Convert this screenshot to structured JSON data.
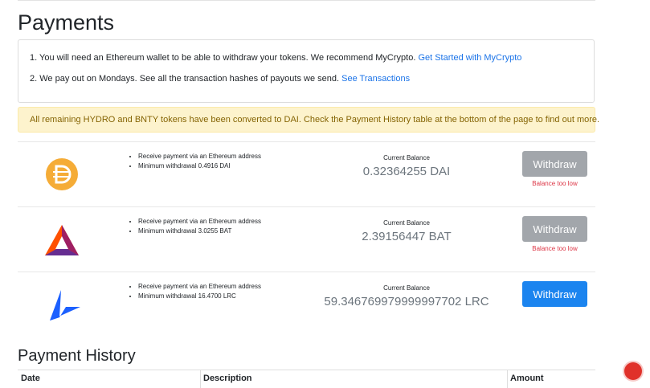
{
  "page": {
    "title": "Payments"
  },
  "info": {
    "line1_text": "1. You will need an Ethereum wallet to be able to withdraw your tokens. We recommend MyCrypto.",
    "line1_link": "Get Started with MyCrypto",
    "line2_text": "2. We pay out on Mondays. See all the transaction hashes of payouts we send.",
    "line2_link": "See Transactions"
  },
  "alert": {
    "text": "All remaining HYDRO and BNTY tokens have been converted to DAI. Check the Payment History table at the bottom of the page to find out more."
  },
  "tokens": [
    {
      "logo_icon": "dai-coin-icon",
      "bullets": [
        "Receive payment via an Ethereum address",
        "Minimum withdrawal 0.4916 DAI"
      ],
      "balance_label": "Current Balance",
      "balance": "0.32364255 DAI",
      "button_label": "Withdraw",
      "button_enabled": false,
      "error": "Balance too low"
    },
    {
      "logo_icon": "bat-triangle-icon",
      "bullets": [
        "Receive payment via an Ethereum address",
        "Minimum withdrawal 3.0255 BAT"
      ],
      "balance_label": "Current Balance",
      "balance": "2.39156447 BAT",
      "button_label": "Withdraw",
      "button_enabled": false,
      "error": "Balance too low"
    },
    {
      "logo_icon": "loopring-icon",
      "bullets": [
        "Receive payment via an Ethereum address",
        "Minimum withdrawal 16.4700 LRC"
      ],
      "balance_label": "Current Balance",
      "balance": "59.346769979999997702 LRC",
      "button_label": "Withdraw",
      "button_enabled": true,
      "error": ""
    }
  ],
  "history": {
    "title": "Payment History",
    "columns": [
      "Date",
      "Description",
      "Amount"
    ]
  },
  "colors": {
    "link": "#1a73e8",
    "alert_bg": "#fdf3cd",
    "alert_text": "#856404",
    "button_disabled": "#a2a6ab",
    "button_enabled": "#1b84ef",
    "error_text": "#dc3545",
    "dai": "#f5ac37",
    "bat": "#ff5000",
    "lrc": "#1c60ff"
  }
}
